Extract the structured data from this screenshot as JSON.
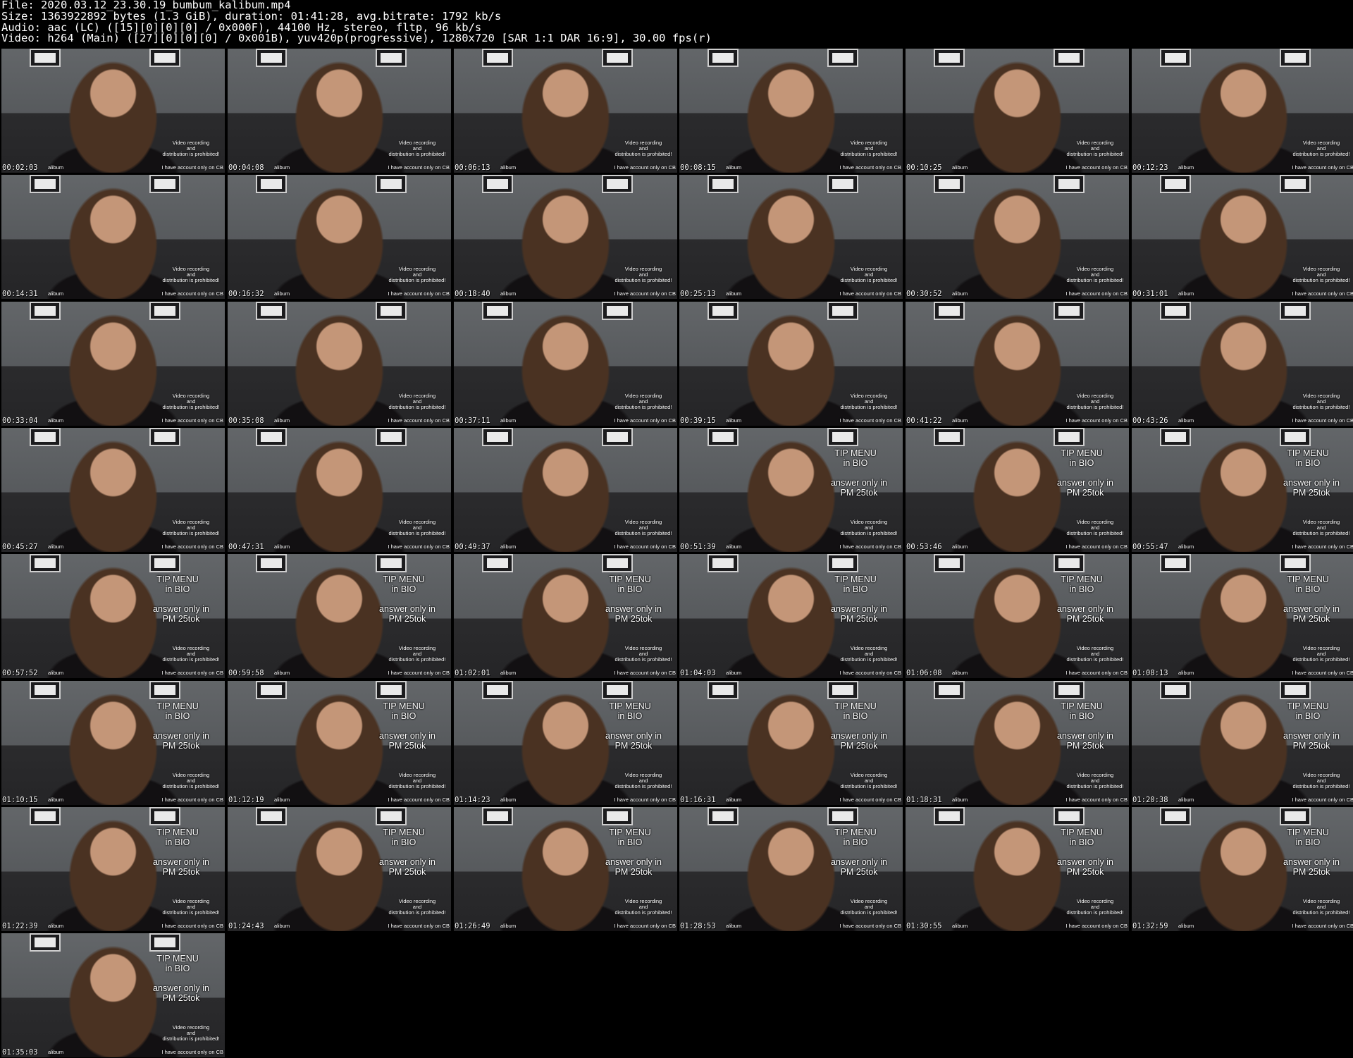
{
  "header": {
    "lines": [
      "File: 2020.03.12_23.30.19_bumbum_kalibum.mp4",
      "Size: 1363922892 bytes (1.3 GiB), duration: 01:41:28, avg.bitrate: 1792 kb/s",
      "Audio: aac (LC) ([15][0][0][0] / 0x000F), 44100 Hz, stereo, fltp, 96 kb/s",
      "Video: h264 (Main) ([27][0][0][0] / 0x001B), yuv420p(progressive), 1280x720 [SAR 1:1 DAR 16:9], 30.00 fps(r)"
    ]
  },
  "overlay": {
    "tip_line1": "TIP MENU",
    "tip_line2": "in BIO",
    "answer_line1": "answer only in",
    "answer_line2": "PM 25tok",
    "warning_line1": "Video recording",
    "warning_line2": "and",
    "warning_line3": "distribution is prohibited!",
    "account_note": "I have account only on CB",
    "nick_fragment": "alibum"
  },
  "thumbnails": [
    {
      "time": "00:02:03",
      "tip_overlay": false
    },
    {
      "time": "00:04:08",
      "tip_overlay": false
    },
    {
      "time": "00:06:13",
      "tip_overlay": false
    },
    {
      "time": "00:08:15",
      "tip_overlay": false
    },
    {
      "time": "00:10:25",
      "tip_overlay": false
    },
    {
      "time": "00:12:23",
      "tip_overlay": false
    },
    {
      "time": "00:14:31",
      "tip_overlay": false
    },
    {
      "time": "00:16:32",
      "tip_overlay": false
    },
    {
      "time": "00:18:40",
      "tip_overlay": false
    },
    {
      "time": "00:25:13",
      "tip_overlay": false
    },
    {
      "time": "00:30:52",
      "tip_overlay": false
    },
    {
      "time": "00:31:01",
      "tip_overlay": false
    },
    {
      "time": "00:33:04",
      "tip_overlay": false
    },
    {
      "time": "00:35:08",
      "tip_overlay": false
    },
    {
      "time": "00:37:11",
      "tip_overlay": false
    },
    {
      "time": "00:39:15",
      "tip_overlay": false
    },
    {
      "time": "00:41:22",
      "tip_overlay": false
    },
    {
      "time": "00:43:26",
      "tip_overlay": false
    },
    {
      "time": "00:45:27",
      "tip_overlay": false
    },
    {
      "time": "00:47:31",
      "tip_overlay": false
    },
    {
      "time": "00:49:37",
      "tip_overlay": false
    },
    {
      "time": "00:51:39",
      "tip_overlay": true
    },
    {
      "time": "00:53:46",
      "tip_overlay": true
    },
    {
      "time": "00:55:47",
      "tip_overlay": true
    },
    {
      "time": "00:57:52",
      "tip_overlay": true
    },
    {
      "time": "00:59:58",
      "tip_overlay": true
    },
    {
      "time": "01:02:01",
      "tip_overlay": true
    },
    {
      "time": "01:04:03",
      "tip_overlay": true
    },
    {
      "time": "01:06:08",
      "tip_overlay": true
    },
    {
      "time": "01:08:13",
      "tip_overlay": true
    },
    {
      "time": "01:10:15",
      "tip_overlay": true
    },
    {
      "time": "01:12:19",
      "tip_overlay": true
    },
    {
      "time": "01:14:23",
      "tip_overlay": true
    },
    {
      "time": "01:16:31",
      "tip_overlay": true
    },
    {
      "time": "01:18:31",
      "tip_overlay": true
    },
    {
      "time": "01:20:38",
      "tip_overlay": true
    },
    {
      "time": "01:22:39",
      "tip_overlay": true
    },
    {
      "time": "01:24:43",
      "tip_overlay": true
    },
    {
      "time": "01:26:49",
      "tip_overlay": true
    },
    {
      "time": "01:28:53",
      "tip_overlay": true
    },
    {
      "time": "01:30:55",
      "tip_overlay": true
    },
    {
      "time": "01:32:59",
      "tip_overlay": true
    },
    {
      "time": "01:35:03",
      "tip_overlay": true
    }
  ]
}
